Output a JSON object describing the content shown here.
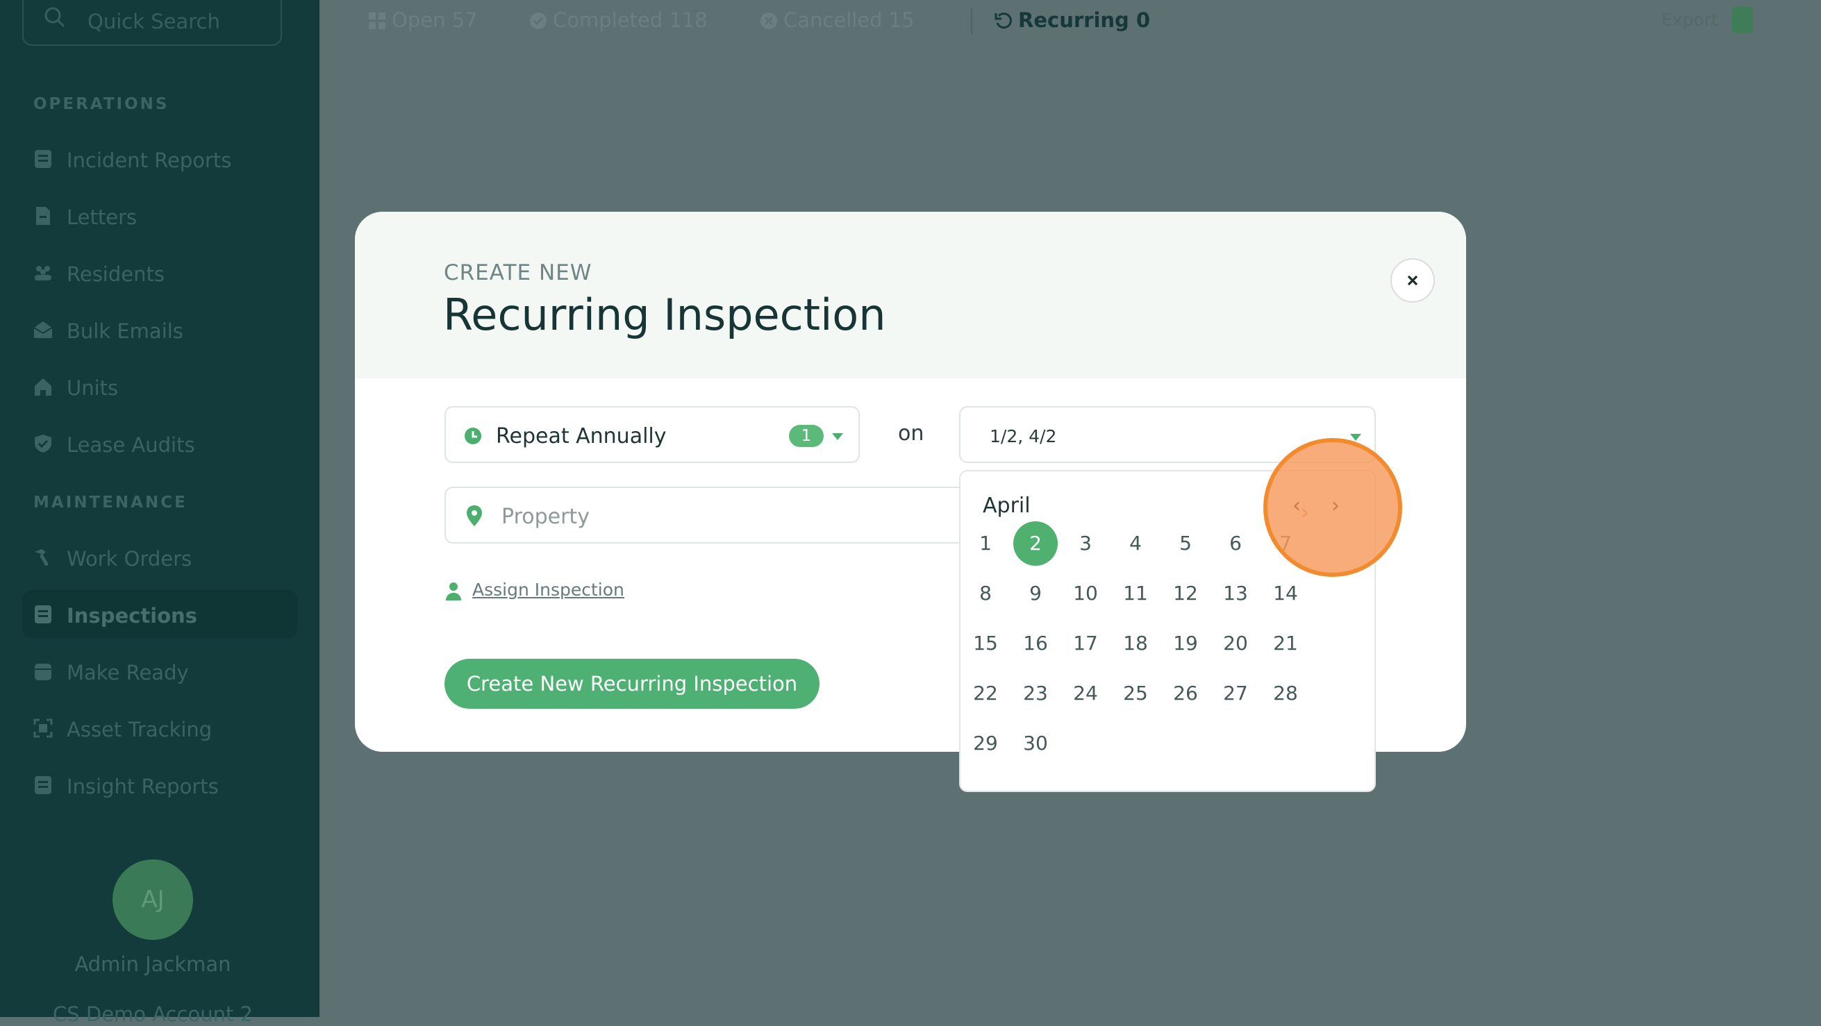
{
  "sidebar": {
    "search_placeholder": "Quick Search",
    "operations_label": "OPERATIONS",
    "maintenance_label": "MAINTENANCE",
    "operations_items": [
      {
        "label": "Incident Reports",
        "icon": "document-icon"
      },
      {
        "label": "Letters",
        "icon": "letter-icon"
      },
      {
        "label": "Residents",
        "icon": "people-icon"
      },
      {
        "label": "Bulk Emails",
        "icon": "envelope-icon"
      },
      {
        "label": "Units",
        "icon": "home-icon"
      },
      {
        "label": "Lease Audits",
        "icon": "shield-icon"
      }
    ],
    "maintenance_items": [
      {
        "label": "Work Orders",
        "icon": "hammer-icon"
      },
      {
        "label": "Inspections",
        "icon": "clipboard-icon",
        "active": true
      },
      {
        "label": "Make Ready",
        "icon": "calendar-icon"
      },
      {
        "label": "Asset Tracking",
        "icon": "scan-icon"
      },
      {
        "label": "Insight Reports",
        "icon": "report-icon"
      }
    ],
    "user": {
      "initials": "AJ",
      "name": "Admin Jackman",
      "account": "CS Demo Account 2"
    }
  },
  "topbar": {
    "tabs": [
      {
        "label": "Open 57",
        "icon": "grid-icon"
      },
      {
        "label": "Completed 118",
        "icon": "check-circle-icon"
      },
      {
        "label": "Cancelled 15",
        "icon": "x-circle-icon"
      },
      {
        "label": "Recurring 0",
        "icon": "refresh-icon",
        "active": true
      }
    ],
    "export_label": "Export"
  },
  "modal": {
    "eyebrow": "CREATE NEW",
    "title": "Recurring Inspection",
    "repeat": {
      "value": "Repeat Annually",
      "badge": "1"
    },
    "on_label": "on",
    "dates_value": "1/2, 4/2",
    "property_placeholder": "Property",
    "assign_label": "Assign Inspection",
    "create_button": "Create New Recurring Inspection"
  },
  "calendar": {
    "month": "April",
    "prev": "‹",
    "next": "›",
    "selected_day": 2,
    "weeks": [
      [
        "1",
        "2",
        "3",
        "4",
        "5",
        "6",
        "7"
      ],
      [
        "8",
        "9",
        "10",
        "11",
        "12",
        "13",
        "14"
      ],
      [
        "15",
        "16",
        "17",
        "18",
        "19",
        "20",
        "21"
      ],
      [
        "22",
        "23",
        "24",
        "25",
        "26",
        "27",
        "28"
      ],
      [
        "29",
        "30"
      ]
    ]
  },
  "colors": {
    "accent": "#4eb073",
    "sidebar": "#133b3b",
    "highlight": "#f28a2e"
  }
}
